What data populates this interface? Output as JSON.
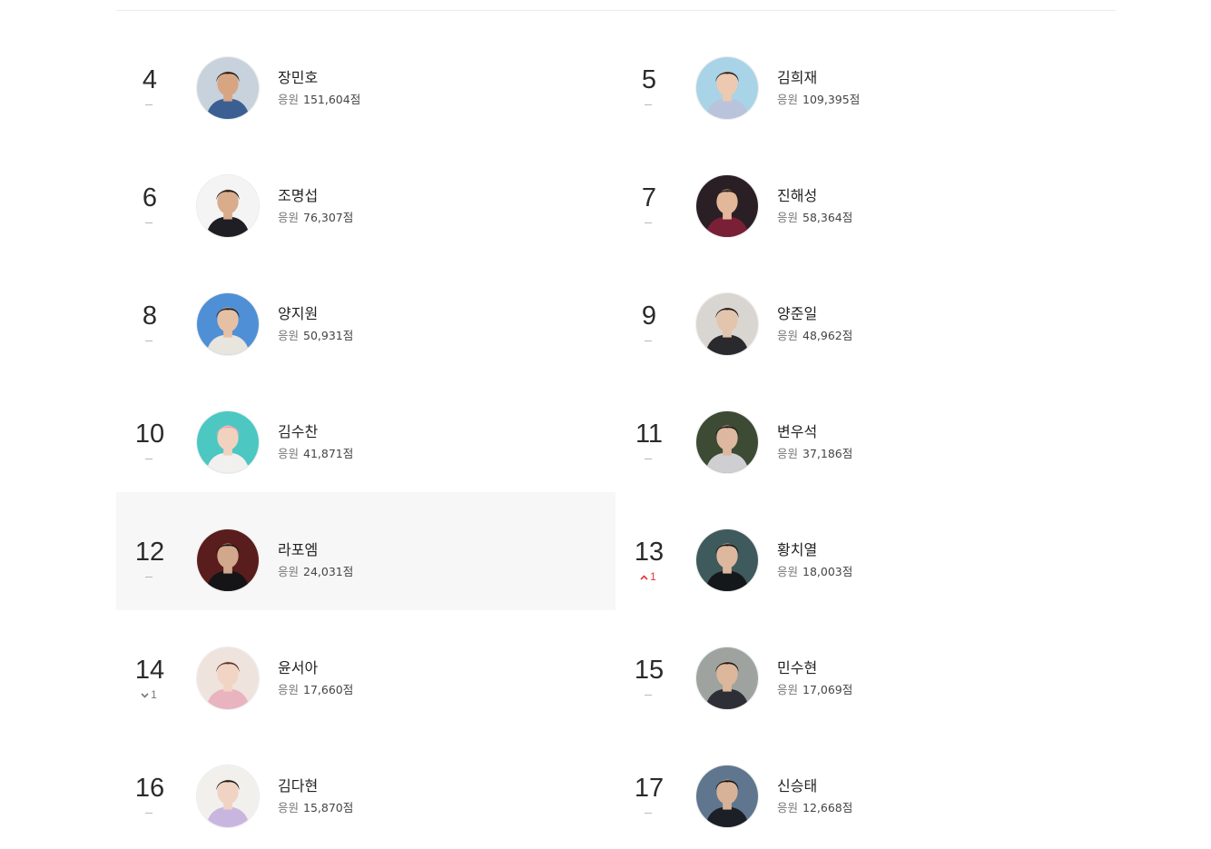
{
  "score_label": "응원",
  "score_unit": "점",
  "ranking": [
    {
      "rank": "4",
      "name": "장민호",
      "score": "151,604",
      "change_type": "same",
      "change_value": "",
      "avatar": {
        "bg": "#c8d2dc",
        "skin": "#d8a583",
        "hair": "#1e1a17",
        "shirt": "#3b5f93"
      }
    },
    {
      "rank": "5",
      "name": "김희재",
      "score": "109,395",
      "change_type": "same",
      "change_value": "",
      "avatar": {
        "bg": "#a9d3e6",
        "skin": "#ecc9b0",
        "hair": "#2a2220",
        "shirt": "#b9c4dc"
      }
    },
    {
      "rank": "6",
      "name": "조명섭",
      "score": "76,307",
      "change_type": "same",
      "change_value": "",
      "avatar": {
        "bg": "#f4f4f4",
        "skin": "#d9ac8c",
        "hair": "#1a1715",
        "shirt": "#1e1e24"
      }
    },
    {
      "rank": "7",
      "name": "진해성",
      "score": "58,364",
      "change_type": "same",
      "change_value": "",
      "avatar": {
        "bg": "#2a1f25",
        "skin": "#e3b89a",
        "hair": "#2b1f1a",
        "shirt": "#7a2036"
      }
    },
    {
      "rank": "8",
      "name": "양지원",
      "score": "50,931",
      "change_type": "same",
      "change_value": "",
      "avatar": {
        "bg": "#4f8fd6",
        "skin": "#e6c0a4",
        "hair": "#2a211c",
        "shirt": "#e8e4de"
      }
    },
    {
      "rank": "9",
      "name": "양준일",
      "score": "48,962",
      "change_type": "same",
      "change_value": "",
      "avatar": {
        "bg": "#d9d6d2",
        "skin": "#e3c4ad",
        "hair": "#1c1816",
        "shirt": "#2a2a2e"
      }
    },
    {
      "rank": "10",
      "name": "김수찬",
      "score": "41,871",
      "change_type": "same",
      "change_value": "",
      "avatar": {
        "bg": "#4cc7c2",
        "skin": "#f0d2bf",
        "hair": "#f0a4b4",
        "shirt": "#f2f0ee"
      }
    },
    {
      "rank": "11",
      "name": "변우석",
      "score": "37,186",
      "change_type": "same",
      "change_value": "",
      "avatar": {
        "bg": "#3d4a34",
        "skin": "#ddb79f",
        "hair": "#201a16",
        "shirt": "#cfcfd1"
      }
    },
    {
      "rank": "12",
      "name": "라포엠",
      "score": "24,031",
      "change_type": "same",
      "change_value": "",
      "highlight": true,
      "avatar": {
        "bg": "#5a1d1d",
        "skin": "#d2a88d",
        "hair": "#191512",
        "shirt": "#151517"
      }
    },
    {
      "rank": "13",
      "name": "황치열",
      "score": "18,003",
      "change_type": "up",
      "change_value": "1",
      "avatar": {
        "bg": "#3f5a5c",
        "skin": "#ddb89e",
        "hair": "#1a1614",
        "shirt": "#15181a"
      }
    },
    {
      "rank": "14",
      "name": "윤서아",
      "score": "17,660",
      "change_type": "down",
      "change_value": "1",
      "avatar": {
        "bg": "#efe3de",
        "skin": "#f2d4c4",
        "hair": "#5a3328",
        "shirt": "#e9b3c0"
      }
    },
    {
      "rank": "15",
      "name": "민수현",
      "score": "17,069",
      "change_type": "same",
      "change_value": "",
      "avatar": {
        "bg": "#9ea3a0",
        "skin": "#ddb79b",
        "hair": "#1e1915",
        "shirt": "#2e2f36"
      }
    },
    {
      "rank": "16",
      "name": "김다현",
      "score": "15,870",
      "change_type": "same",
      "change_value": "",
      "avatar": {
        "bg": "#f2f0ed",
        "skin": "#f0d3c2",
        "hair": "#1b1614",
        "shirt": "#c9b6e0"
      }
    },
    {
      "rank": "17",
      "name": "신승태",
      "score": "12,668",
      "change_type": "same",
      "change_value": "",
      "avatar": {
        "bg": "#60768f",
        "skin": "#d8b297",
        "hair": "#171412",
        "shirt": "#1c1f26"
      }
    }
  ]
}
